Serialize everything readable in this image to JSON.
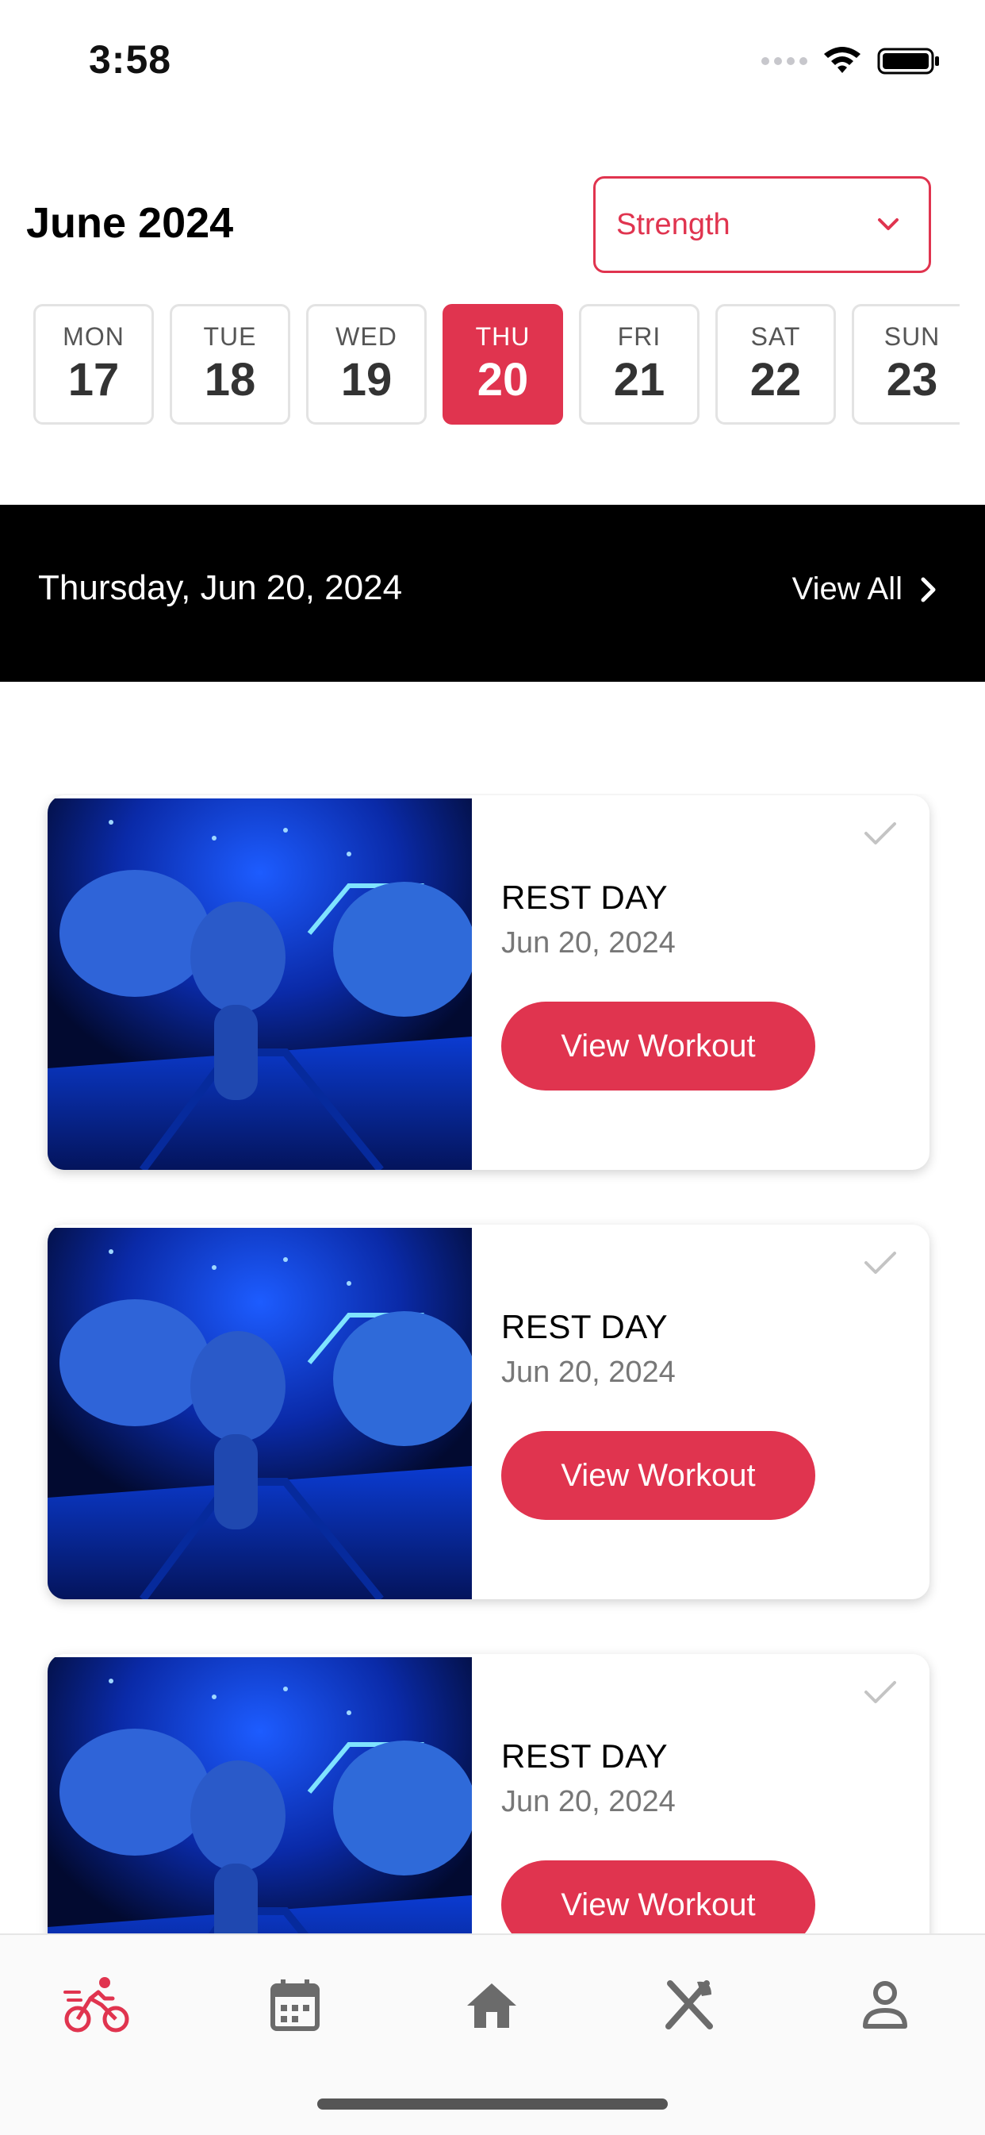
{
  "status_bar": {
    "time": "3:58"
  },
  "header": {
    "month_title": "June 2024",
    "category_select": {
      "value": "Strength"
    }
  },
  "date_strip": {
    "days": [
      {
        "dow": "MON",
        "num": "17",
        "selected": false
      },
      {
        "dow": "TUE",
        "num": "18",
        "selected": false
      },
      {
        "dow": "WED",
        "num": "19",
        "selected": false
      },
      {
        "dow": "THU",
        "num": "20",
        "selected": true
      },
      {
        "dow": "FRI",
        "num": "21",
        "selected": false
      },
      {
        "dow": "SAT",
        "num": "22",
        "selected": false
      },
      {
        "dow": "SUN",
        "num": "23",
        "selected": false
      }
    ]
  },
  "banner": {
    "date": "Thursday, Jun 20, 2024",
    "view_all": "View All"
  },
  "cards": [
    {
      "title": "REST DAY",
      "date": "Jun 20, 2024",
      "button": "View Workout"
    },
    {
      "title": "REST DAY",
      "date": "Jun 20, 2024",
      "button": "View Workout"
    },
    {
      "title": "REST DAY",
      "date": "Jun 20, 2024",
      "button": "View Workout"
    }
  ],
  "tab_bar": {
    "items": [
      {
        "icon": "cycling-icon",
        "active": true
      },
      {
        "icon": "calendar-icon",
        "active": false
      },
      {
        "icon": "home-icon",
        "active": false
      },
      {
        "icon": "fork-knife-icon",
        "active": false
      },
      {
        "icon": "profile-icon",
        "active": false
      }
    ]
  },
  "colors": {
    "accent": "#e0344f",
    "banner_bg": "#000000",
    "tab_inactive": "#6b6b6b"
  }
}
